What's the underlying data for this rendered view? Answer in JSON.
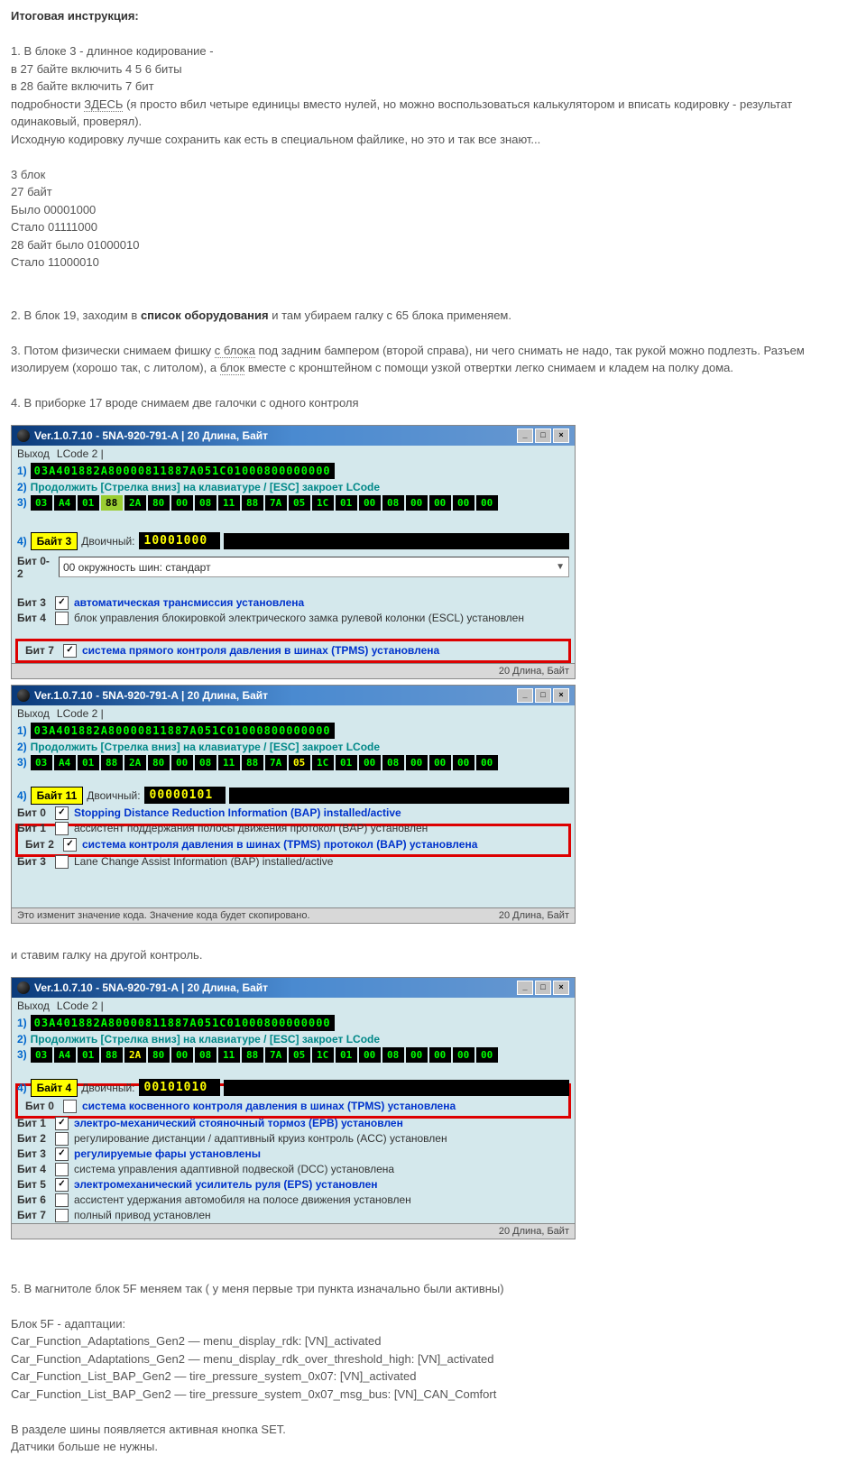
{
  "intro": {
    "t": "Итоговая инструкция:",
    "l1": "1. В блоке 3 - длинное кодирование -",
    "l2": "в 27 байте включить 4 5 6 биты",
    "l3": "в 28 байте включить 7 бит",
    "l4a": "подробности ",
    "l4l": "ЗДЕСЬ",
    "l4b": " (я просто вбил четыре единицы вместо нулей, но можно воспользоваться калькулятором и вписать кодировку - результат одинаковый, проверял).",
    "l5": "Исходную кодировку лучше сохранить как есть в специальном файлике, но это и так все знают...",
    "l6": "3 блок",
    "l7": "27 байт",
    "l8": "Было 00001000",
    "l9": "Стало 01111000",
    "l10": "28 байт было 01000010",
    "l11": "Стало 11000010",
    "l12a": "2. В блок 19, заходим в ",
    "l12b": "список оборудования",
    "l12c": " и там убираем галку с 65 блока применяем.",
    "l13a": "3. Потом физически снимаем фишку ",
    "l13l1": "с блока",
    "l13b": " под задним бампером (второй справа), ни чего снимать не надо, так рукой можно подлезть. Разъем изолируем (хорошо так, с литолом), а ",
    "l13l2": "блок",
    "l13c": " вместе с кронштейном с помощи узкой отвертки легко снимаем и кладем на полку дома.",
    "l14": "4. В приборке 17 вроде снимаем две галочки с одного контроля"
  },
  "w1": {
    "title": "Ver.1.0.7.10 -  5NA-920-791-A | 20 Длина, Байт",
    "m1": "Выход",
    "m2": "LCode 2 |",
    "hex": "03A401882A80000811887A051C01000800000000",
    "hint": "Продолжить [Стрелка вниз] на клавиатуре / [ESC] закроет LCode",
    "bytes": [
      "03",
      "A4",
      "01",
      "88",
      "2A",
      "80",
      "00",
      "08",
      "11",
      "88",
      "7A",
      "05",
      "1C",
      "01",
      "00",
      "08",
      "00",
      "00",
      "00",
      "00"
    ],
    "blbl": "Байт 3",
    "bd": "Двоичный:",
    "bin": "10001000",
    "r02l": "Бит 0-2",
    "r02v": "00 окружность шин: стандарт",
    "b3": "Бит 3",
    "b3t": "автоматическая трансмиссия установлена",
    "b4": "Бит 4",
    "b4t": "блок управления блокировкой электрического замка рулевой колонки (ESCL) установлен",
    "b7": "Бит 7",
    "b7t": "система прямого контроля давления в шинах (TPMS) установлена",
    "stat": "20 Длина, Байт"
  },
  "w2": {
    "title": "Ver.1.0.7.10 -  5NA-920-791-A | 20 Длина, Байт",
    "m1": "Выход",
    "m2": "LCode 2 |",
    "hex": "03A401882A80000811887A051C01000800000000",
    "hint": "Продолжить [Стрелка вниз] на клавиатуре / [ESC] закроет LCode",
    "bytes": [
      "03",
      "A4",
      "01",
      "88",
      "2A",
      "80",
      "00",
      "08",
      "11",
      "88",
      "7A",
      "05",
      "1C",
      "01",
      "00",
      "08",
      "00",
      "00",
      "00",
      "00"
    ],
    "blbl": "Байт 11",
    "bd": "Двоичный:",
    "bin": "00000101",
    "b0": "Бит 0",
    "b0t": "Stopping Distance Reduction Information (BAP) installed/active",
    "b1": "Бит 1",
    "b1t": "ассистент поддержания полосы движения протокол (BAP) установлен",
    "b2": "Бит 2",
    "b2t": "система контроля давления в шинах (TPMS) протокол (BAP) установлена",
    "b3": "Бит 3",
    "b3t": "Lane Change Assist Information (BAP) installed/active",
    "st1": "Это изменит значение кода.  Значение кода будет скопировано.",
    "st2": "20 Длина, Байт"
  },
  "mid": "и ставим галку на другой контроль.",
  "w3": {
    "title": "Ver.1.0.7.10 -  5NA-920-791-A | 20 Длина, Байт",
    "m1": "Выход",
    "m2": "LCode 2 |",
    "hex": "03A401882A80000811887A051C01000800000000",
    "hint": "Продолжить [Стрелка вниз] на клавиатуре / [ESC] закроет LCode",
    "bytes": [
      "03",
      "A4",
      "01",
      "88",
      "2A",
      "80",
      "00",
      "08",
      "11",
      "88",
      "7A",
      "05",
      "1C",
      "01",
      "00",
      "08",
      "00",
      "00",
      "00",
      "00"
    ],
    "blbl": "Байт 4",
    "bd": "Двоичный:",
    "bin": "00101010",
    "b0": "Бит 0",
    "b0t": "система косвенного контроля давления в шинах (TPMS) установлена",
    "b1": "Бит 1",
    "b1t": "электро-механический стояночный тормоз (EPB) установлен",
    "b2": "Бит 2",
    "b2t": "регулирование дистанции / адаптивный круиз контроль (ACC) установлен",
    "b3": "Бит 3",
    "b3t": "регулируемые фары установлены",
    "b4": "Бит 4",
    "b4t": "система управления адаптивной подвеской (DCC) установлена",
    "b5": "Бит 5",
    "b5t": "электромеханический усилитель руля (EPS) установлен",
    "b6": "Бит 6",
    "b6t": "ассистент удержания автомобиля на полосе движения установлен",
    "b7": "Бит 7",
    "b7t": "полный привод установлен",
    "stat": "20 Длина, Байт"
  },
  "end": {
    "l1": "5. В магнитоле блок 5F меняем так ( у меня первые три пункта изначально были активны)",
    "l2": "Блок 5F - адаптации:",
    "l3": "Car_Function_Adaptations_Gen2 — menu_display_rdk: [VN]_activated",
    "l4": "Car_Function_Adaptations_Gen2 — menu_display_rdk_over_threshold_high: [VN]_activated",
    "l5": "Car_Function_List_BAP_Gen2 — tire_pressure_system_0x07: [VN]_activated",
    "l6": "Car_Function_List_BAP_Gen2 — tire_pressure_system_0x07_msg_bus: [VN]_CAN_Comfort",
    "l7": "В разделе шины появляется активная кнопка SET.",
    "l8": "Датчики больше не нужны."
  }
}
